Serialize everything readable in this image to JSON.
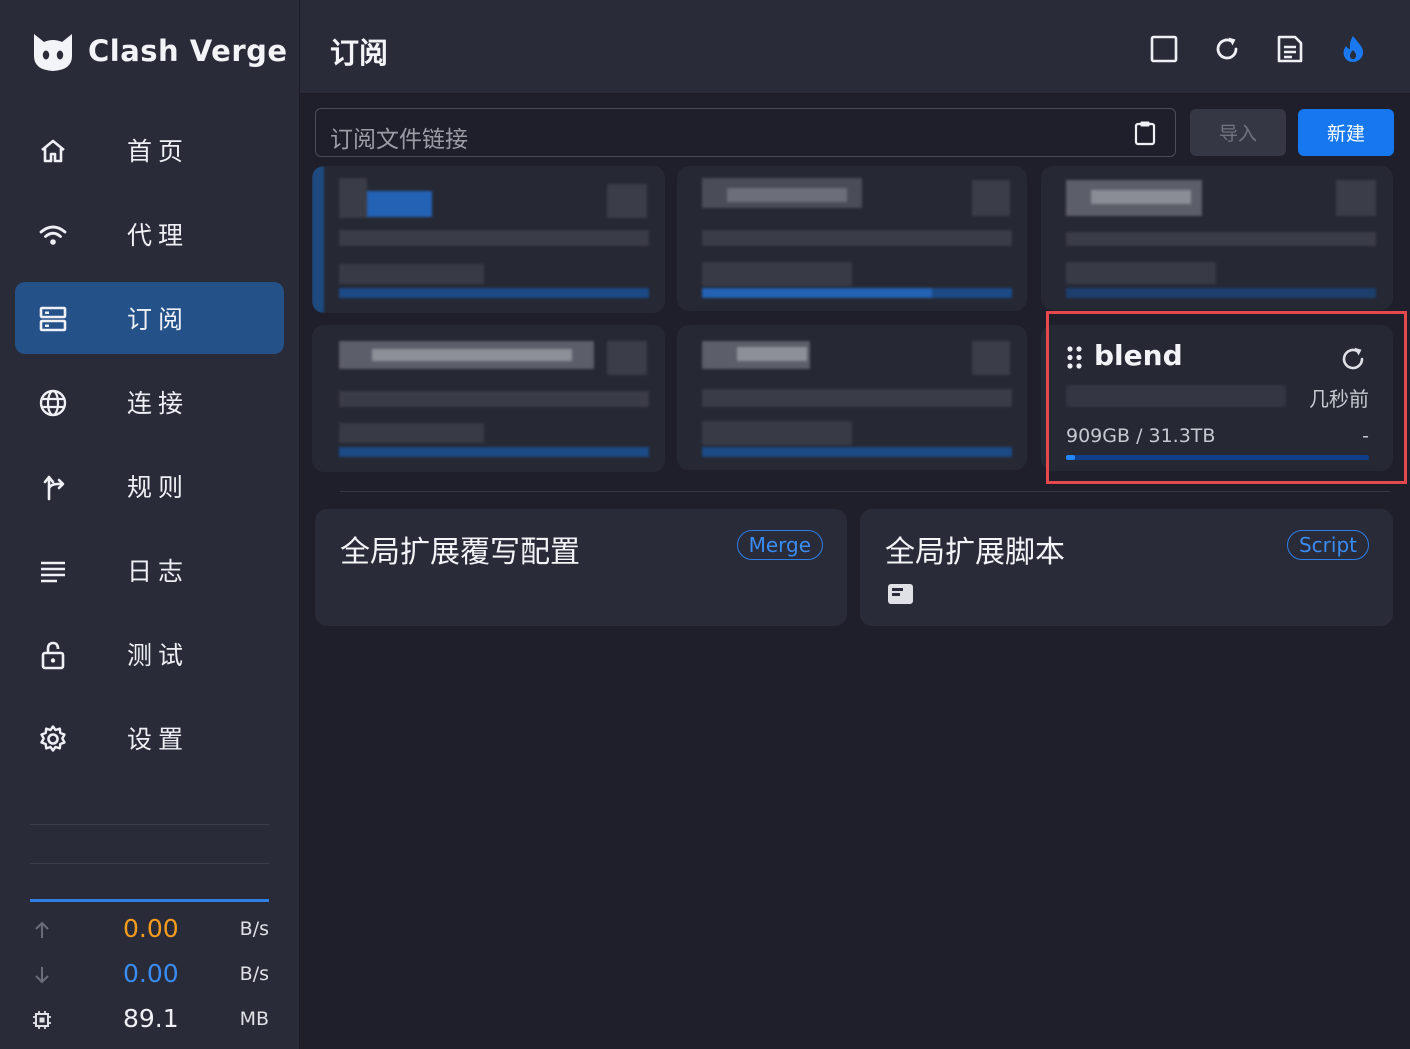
{
  "app": {
    "name": "Clash Verge"
  },
  "sidebar": {
    "items": [
      {
        "label": "首页",
        "icon": "home-icon",
        "active": false
      },
      {
        "label": "代理",
        "icon": "wifi-icon",
        "active": false
      },
      {
        "label": "订阅",
        "icon": "server-icon",
        "active": true
      },
      {
        "label": "连接",
        "icon": "globe-icon",
        "active": false
      },
      {
        "label": "规则",
        "icon": "fork-icon",
        "active": false
      },
      {
        "label": "日志",
        "icon": "list-icon",
        "active": false
      },
      {
        "label": "测试",
        "icon": "lock-icon",
        "active": false
      },
      {
        "label": "设置",
        "icon": "gear-icon",
        "active": false
      }
    ],
    "traffic": {
      "upload": {
        "value": "0.00",
        "unit": "B/s",
        "color": "#f39c1f"
      },
      "download": {
        "value": "0.00",
        "unit": "B/s",
        "color": "#3a8cf2"
      },
      "memory": {
        "value": "89.1",
        "unit": "MB"
      }
    }
  },
  "header": {
    "title": "订阅",
    "buttons": [
      "window-icon",
      "refresh-icon",
      "file-icon",
      "flame-icon"
    ]
  },
  "toolbar": {
    "url_placeholder": "订阅文件链接",
    "import_label": "导入",
    "new_label": "新建"
  },
  "profiles": {
    "active_profile": {
      "name": "blend",
      "updated": "几秒前",
      "usage": "909GB / 31.3TB",
      "expire": "-",
      "usage_fraction": 0.03
    }
  },
  "global": {
    "merge": {
      "title": "全局扩展覆写配置",
      "tag": "Merge"
    },
    "script": {
      "title": "全局扩展脚本",
      "tag": "Script"
    }
  },
  "colors": {
    "accent": "#1677ee",
    "active_nav": "#255189",
    "highlight": "#e5484d"
  }
}
